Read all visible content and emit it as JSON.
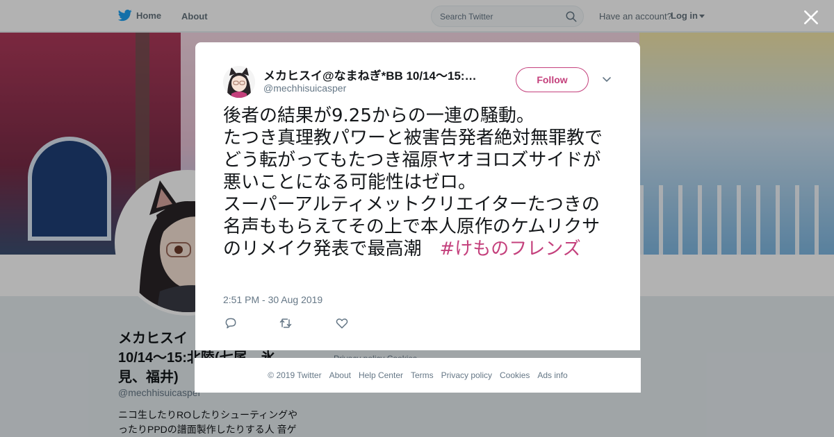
{
  "topbar": {
    "home_label": "Home",
    "about_label": "About",
    "search_placeholder": "Search Twitter",
    "have_account": "Have an account?",
    "login_label": "Log in"
  },
  "profile": {
    "name": "メカヒスイ@なまねぎ*BB 10/14～15:北陸(七尾、氷見、福井)",
    "name_visible": "メカヒスイ",
    "name_line2": "10/14～15:北陸(七尾、氷",
    "name_line3": "見、福井)",
    "handle": "@mechhisuicasper",
    "bio_line1": "ニコ生したりROしたりシューティングや",
    "bio_line2": "ったりPPDの譜面製作したりする人 音ゲ",
    "side_footer": "Privacy policy  Cookies"
  },
  "tweet": {
    "author_name": "メカヒスイ@なまねぎ*BB 10/14～15:北陸(七尾、氷見、福井)",
    "author_handle": "@mechhisuicasper",
    "follow_label": "Follow",
    "text": "後者の結果が9.25からの一連の騒動。\nたつき真理教パワーと被害告発者絶対無罪教でどう転がってもたつき福原ヤオヨロズサイドが悪いことになる可能性はゼロ。\nスーパーアルティメットクリエイターたつきの名声ももらえてその上で本人原作のケムリクサのリメイク発表で最高潮　",
    "hashtag": "#けものフレンズ",
    "timestamp": "2:51 PM - 30 Aug 2019"
  },
  "footer": {
    "copyright": "© 2019 Twitter",
    "about": "About",
    "help": "Help Center",
    "terms": "Terms",
    "privacy": "Privacy policy",
    "cookies": "Cookies",
    "ads": "Ads info"
  },
  "colors": {
    "accent": "#c4407c",
    "twitter_blue": "#1da1f2",
    "muted": "#657786"
  },
  "icons": {
    "logo": "twitter-bird-icon",
    "search": "search-icon",
    "close": "close-icon",
    "more": "chevron-down-icon",
    "reply": "reply-icon",
    "retweet": "retweet-icon",
    "like": "heart-icon"
  }
}
